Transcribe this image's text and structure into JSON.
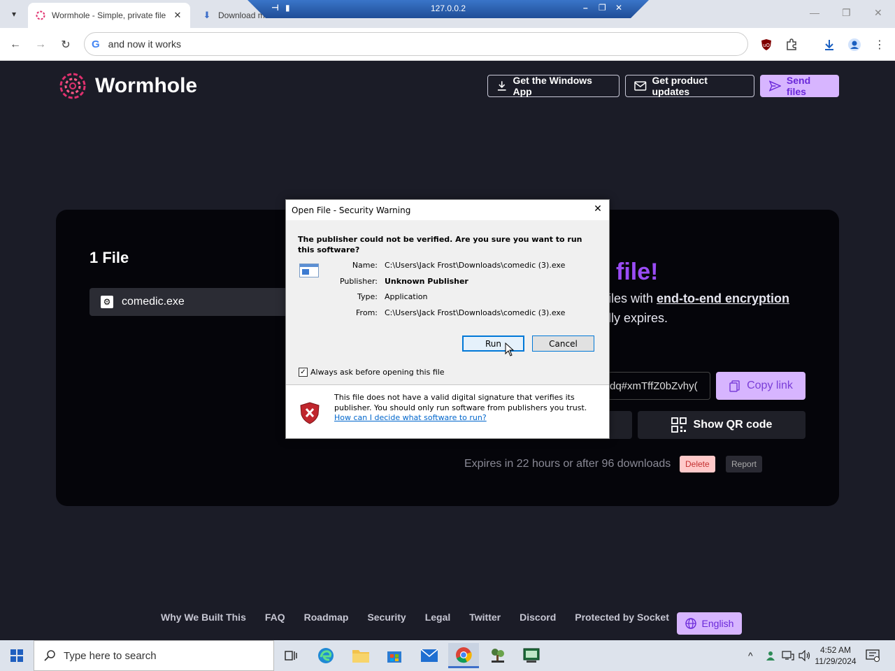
{
  "browser": {
    "tabs": [
      {
        "title": "Wormhole - Simple, private file",
        "active": true
      },
      {
        "title": "Download m...",
        "active": false
      }
    ],
    "remote_bar": {
      "host": "127.0.0.2"
    },
    "address": "and now it works",
    "address_icon": "G"
  },
  "header": {
    "logo": "Wormhole",
    "buttons": {
      "windows_app": "Get the Windows App",
      "updates": "Get product updates",
      "send": "Send files"
    }
  },
  "card": {
    "files_title": "1 File",
    "file_name": "comedic.exe",
    "heading_fragment": "file!",
    "line1_prefix": "iles with ",
    "line1_link": "end-to-end encryption",
    "line2": "lly expires.",
    "link_value": "dq#xmTffZ0bZvhy(",
    "copy_link": "Copy link",
    "qr": "Show QR code",
    "expires": "Expires in 22 hours or after 96 downloads",
    "delete": "Delete",
    "report": "Report"
  },
  "footer": {
    "links": [
      "Why We Built This",
      "FAQ",
      "Roadmap",
      "Security",
      "Legal",
      "Twitter",
      "Discord",
      "Protected by Socket"
    ],
    "language": "English"
  },
  "dialog": {
    "title": "Open File - Security Warning",
    "question": "The publisher could not be verified.  Are you sure you want to run this software?",
    "fields": {
      "name_label": "Name:",
      "name_value": "C:\\Users\\Jack Frost\\Downloads\\comedic (3).exe",
      "publisher_label": "Publisher:",
      "publisher_value": "Unknown Publisher",
      "type_label": "Type:",
      "type_value": "Application",
      "from_label": "From:",
      "from_value": "C:\\Users\\Jack Frost\\Downloads\\comedic (3).exe"
    },
    "run": "Run",
    "cancel": "Cancel",
    "checkbox": "Always ask before opening this file",
    "checkbox_checked": true,
    "warning": "This file does not have a valid digital signature that verifies its publisher.  You should only run software from publishers you trust.",
    "help_link": "How can I decide what software to run?"
  },
  "taskbar": {
    "search_placeholder": "Type here to search",
    "time": "4:52 AM",
    "date": "11/29/2024"
  }
}
